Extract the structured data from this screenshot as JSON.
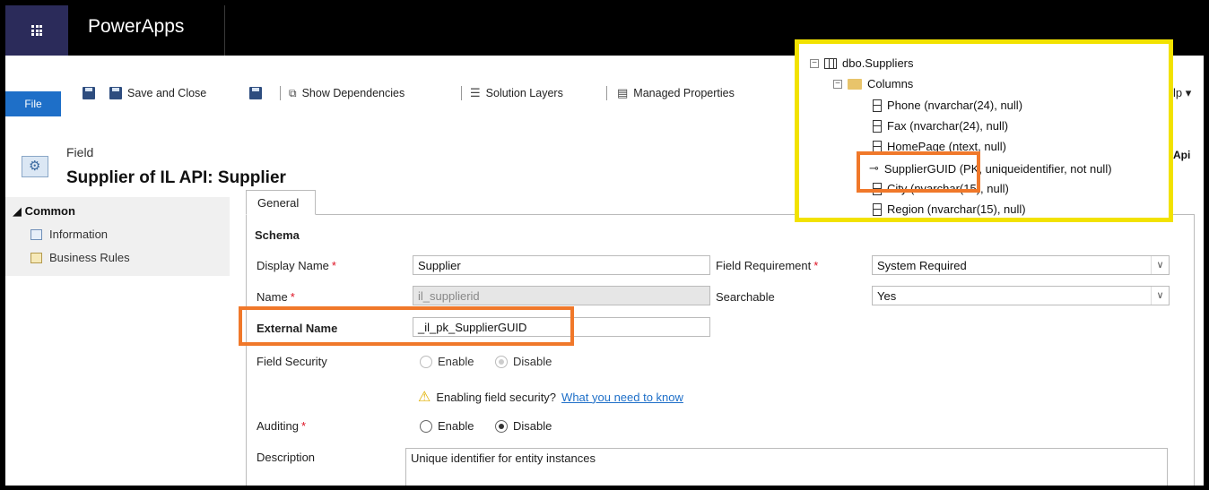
{
  "app": {
    "title": "PowerApps"
  },
  "command_bar": {
    "file_label": "File",
    "save_close_label": "Save and Close",
    "show_dependencies_label": "Show Dependencies",
    "solution_layers_label": "Solution Layers",
    "managed_properties_label": "Managed Properties",
    "help_label": "lp ▾"
  },
  "header": {
    "entity_type": "Field",
    "title": "Supplier of IL API: Supplier",
    "right_text": "Api"
  },
  "left_nav": {
    "section": "◢ Common",
    "items": [
      {
        "label": "Information"
      },
      {
        "label": "Business Rules"
      }
    ]
  },
  "tabs": {
    "general": "General"
  },
  "form": {
    "schema_heading": "Schema",
    "display_name_label": "Display Name",
    "display_name_value": "Supplier",
    "name_label": "Name",
    "name_value": "il_supplierid",
    "external_name_label": "External Name",
    "external_name_value": "_il_pk_SupplierGUID",
    "field_security_label": "Field Security",
    "field_security_enable": "Enable",
    "field_security_disable": "Disable",
    "warning_text": "Enabling field security?",
    "warning_link": "What you need to know",
    "auditing_label": "Auditing",
    "auditing_enable": "Enable",
    "auditing_disable": "Disable",
    "description_label": "Description",
    "description_value": "Unique identifier for entity instances",
    "field_requirement_label": "Field Requirement",
    "field_requirement_value": "System Required",
    "searchable_label": "Searchable",
    "searchable_value": "Yes",
    "required_mark": "*"
  },
  "tree": {
    "table": "dbo.Suppliers",
    "folder": "Columns",
    "columns": [
      "Phone (nvarchar(24), null)",
      "Fax (nvarchar(24), null)",
      "HomePage (ntext, null)",
      "SupplierGUID (PK, uniqueidentifier, not null)",
      "City (nvarchar(15), null)",
      "Region (nvarchar(15), null)"
    ]
  },
  "colors": {
    "highlight_orange": "#f0782a",
    "highlight_yellow": "#f2e200",
    "file_button": "#1e6fc8",
    "waffle_bg": "#2b2b5a"
  }
}
